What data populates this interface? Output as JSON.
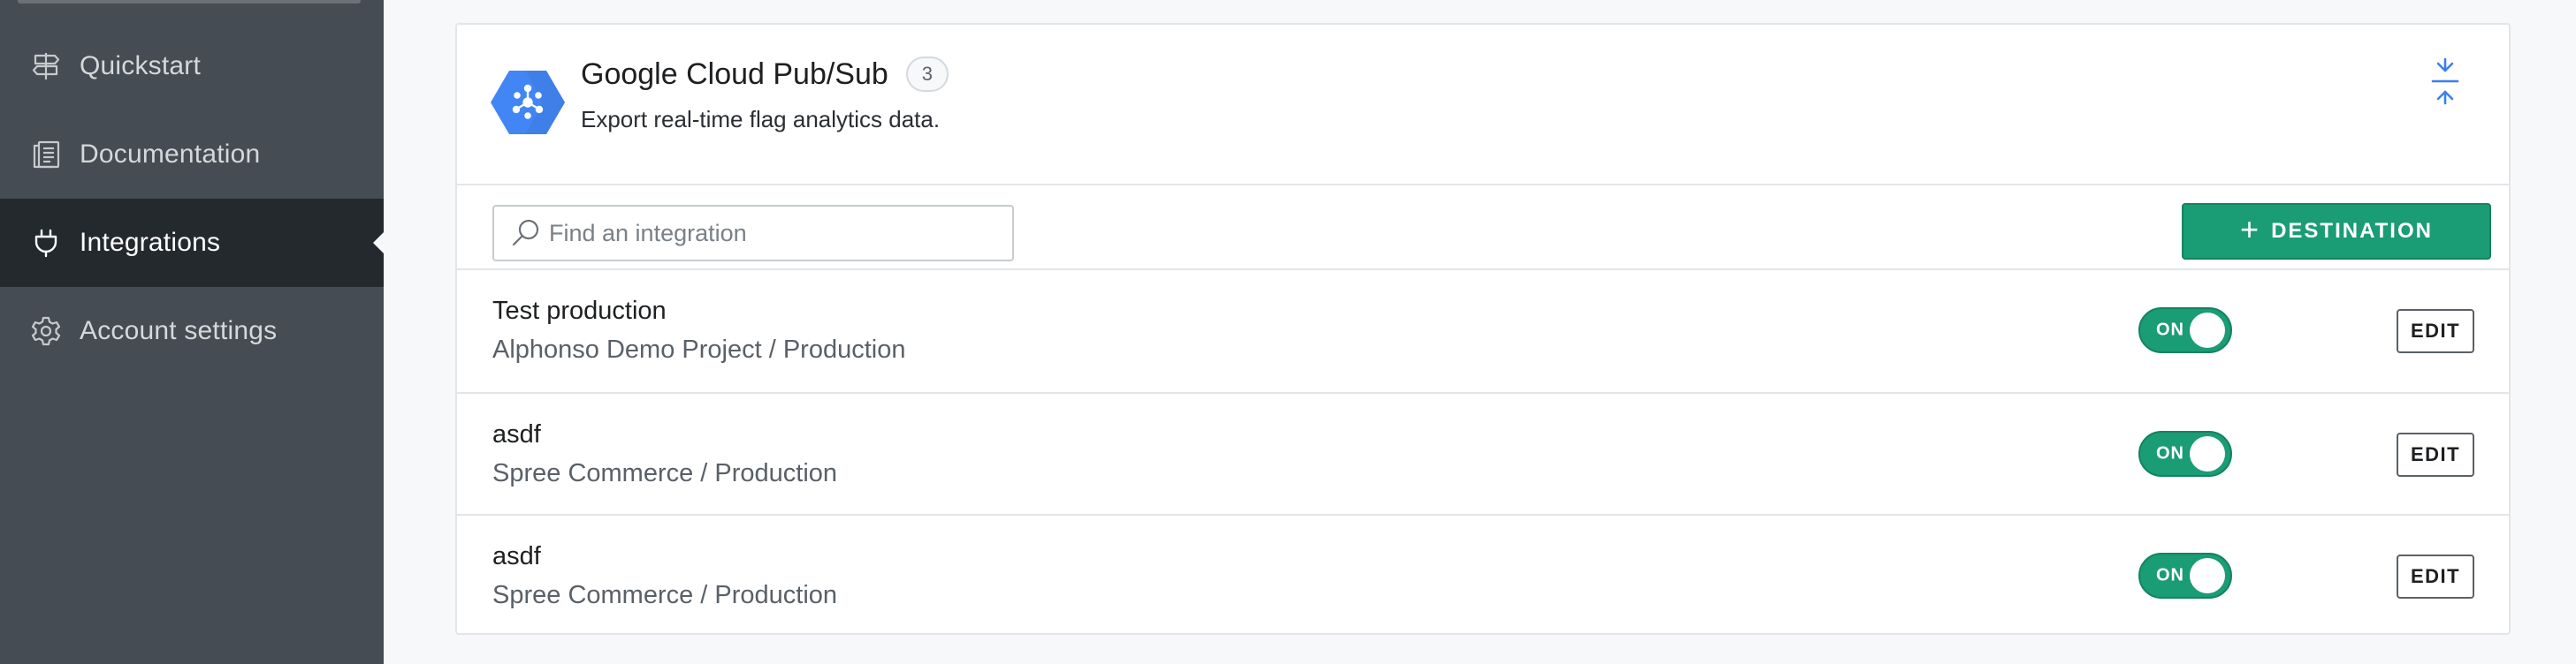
{
  "sidebar": {
    "items": [
      {
        "label": "Quickstart",
        "icon": "signpost-icon",
        "active": false
      },
      {
        "label": "Documentation",
        "icon": "book-icon",
        "active": false
      },
      {
        "label": "Integrations",
        "icon": "plug-icon",
        "active": true
      },
      {
        "label": "Account settings",
        "icon": "gear-icon",
        "active": false
      }
    ]
  },
  "card": {
    "title": "Google Cloud Pub/Sub",
    "count": "3",
    "subtitle": "Export real-time flag analytics data.",
    "logo_icon": "google-cloud-pubsub-logo",
    "collapse_icon": "collapse-icon"
  },
  "toolbar": {
    "search_placeholder": "Find an integration",
    "search_value": "",
    "destination_label": "DESTINATION"
  },
  "rows": [
    {
      "title": "Test production",
      "subtitle": "Alphonso Demo Project / Production",
      "toggle": "ON",
      "edit": "EDIT"
    },
    {
      "title": "asdf",
      "subtitle": "Spree Commerce / Production",
      "toggle": "ON",
      "edit": "EDIT"
    },
    {
      "title": "asdf",
      "subtitle": "Spree Commerce / Production",
      "toggle": "ON",
      "edit": "EDIT"
    }
  ],
  "colors": {
    "sidebar_bg": "#454c53",
    "sidebar_active_bg": "#24292e",
    "accent_green": "#1a9c75",
    "logo_blue": "#4285f4",
    "collapse_blue": "#3b7ff0"
  }
}
